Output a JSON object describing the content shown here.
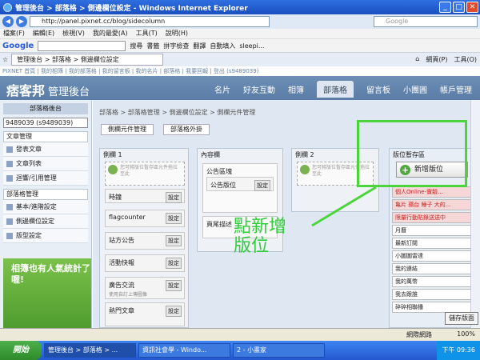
{
  "window": {
    "title": "管理後台 > 部落格 > 側邊欄位設定 - Windows Internet Explorer"
  },
  "address": {
    "url": "http://panel.pixnet.cc/blog/sidecolumn",
    "search_placeholder": "Google"
  },
  "menu": [
    "檔案(F)",
    "編輯(E)",
    "檢視(V)",
    "我的最愛(A)",
    "工具(T)",
    "說明(H)"
  ],
  "gtoolbar": {
    "logo": "Google",
    "search_label": "搜尋",
    "bookmarks": "書籤",
    "spell": "拼字檢查",
    "translate": "翻譯",
    "autofill": "自動填入",
    "user": "sleepi..."
  },
  "tab": {
    "label": "管理後台 > 部落格 > 側邊欄位設定"
  },
  "commands": {
    "page": "網頁(P)",
    "tools": "工具(O)"
  },
  "pixnet": {
    "toplinks": "PIXNET 首頁 | 我的相簿 | 我的部落格 | 我的留言板 | 我的名片 | 部落格 | 我要回報 | 登出 (s9489039)",
    "logo": "痞客邦",
    "logo_sub": "管理後台",
    "nav": [
      "名片",
      "好友互動",
      "相簿",
      "部落格",
      "留言板",
      "小團圓",
      "帳戶管理"
    ]
  },
  "sidebar": {
    "title": "部落格後台",
    "select_value": "9489039 (s9489039)",
    "sections": [
      {
        "title": "文章管理",
        "items": [
          "發表文章",
          "文章列表",
          "迴響/引用管理"
        ]
      },
      {
        "title": "部落格管理",
        "items": [
          "基本/進階設定",
          "側邊欄位設定",
          "版型設定"
        ]
      }
    ],
    "ad_text": "相簿也有人氣統計了喔!"
  },
  "main": {
    "breadcrumb": "部落格  >  部落格管理  >  側邊欄位設定  >  側欄元件管理",
    "subtabs": [
      "側欄元件管理",
      "部落格外掛"
    ],
    "columns": [
      {
        "title": "側欄 1",
        "dropzone": "您可將版位暫存區元件拖拉至此",
        "widgets": [
          "時鐘",
          "flagcounter",
          "站方公告",
          "活動快報",
          "廣告交流",
          "熱門文章"
        ],
        "widget_note": "使用自訂上傳圖像"
      },
      {
        "title": "內容欄",
        "widgets": [
          "公告區塊",
          "公告版位",
          "頁尾描述"
        ]
      },
      {
        "title": "側欄 2",
        "dropzone": "您可將版位暫存區元件拖拉至此"
      }
    ],
    "setting_label": "設定",
    "palette": {
      "title": "版位暫存區",
      "add_button": "新增版位",
      "items": [
        {
          "label": "個人Online-實驗...",
          "highlight": true
        },
        {
          "label": "亀片 蘋台 睡子 大的...",
          "highlight": true
        },
        {
          "label": "限量行動貼錄送送中",
          "highlight": true
        },
        {
          "label": "月曆",
          "highlight": false
        },
        {
          "label": "最新訂閱",
          "highlight": false
        },
        {
          "label": "小圖圖雷達",
          "highlight": false
        },
        {
          "label": "我的連結",
          "highlight": false
        },
        {
          "label": "我的萬幣",
          "highlight": false
        },
        {
          "label": "我去跟誰",
          "highlight": false
        },
        {
          "label": "碎碎相聯播",
          "highlight": false
        }
      ]
    },
    "save_button": "儲存版面"
  },
  "annotation": {
    "text": "點新增\n版位"
  },
  "statusbar": {
    "zone": "網際網路",
    "zoom": "100%"
  },
  "taskbar": {
    "start": "開始",
    "tasks": [
      "管理後台 > 部落格 > ...",
      "資訊社會學 - Windo...",
      "2 - 小畫家"
    ],
    "clock": "下午 09:36"
  },
  "colors": {
    "accent_green": "#4cd43c",
    "pixnet_blue": "#5a7ca6"
  }
}
